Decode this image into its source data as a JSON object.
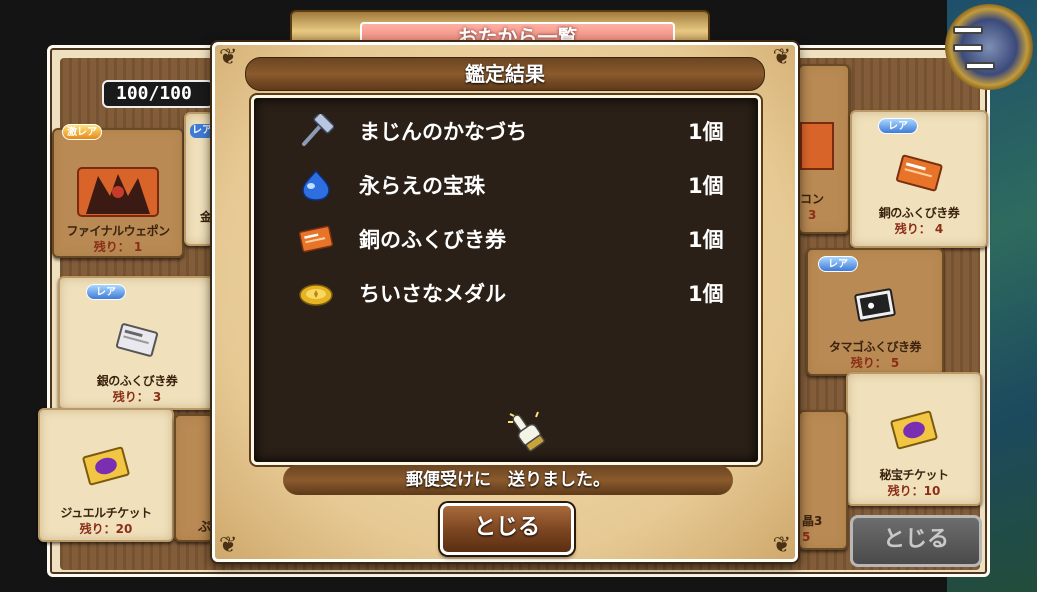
{
  "screen": {
    "title": "おたから一覧",
    "count": "100/100",
    "close_label": "とじる"
  },
  "background_cards": [
    {
      "badge": "激レア",
      "name": "ファイナルウェポン",
      "remain": "残り： 1",
      "icon": "monster-weapon-icon"
    },
    {
      "badge": "レア",
      "name": "銀のふくびき券",
      "remain": "残り： 3",
      "icon": "silver-ticket-icon"
    },
    {
      "badge": "",
      "name": "ジュエルチケット",
      "remain": "残り：20",
      "icon": "jewel-ticket-icon"
    },
    {
      "badge": "レア",
      "name": "銅のふくびき券",
      "remain": "残り： 4",
      "icon": "bronze-ticket-icon"
    },
    {
      "badge": "レア",
      "name": "タマゴふくびき券",
      "remain": "残り： 5",
      "icon": "egg-ticket-icon"
    },
    {
      "badge": "",
      "name": "秘宝チケット",
      "remain": "残り：10",
      "icon": "treasure-ticket-icon"
    }
  ],
  "background_partial": {
    "left_rare": "レア",
    "left_char": "金",
    "left_char2": "ぷ",
    "right_kon": "コン",
    "right_kon_num": "3",
    "right_crystal": "晶3",
    "right_crystal_num": "5"
  },
  "dialog": {
    "title": "鑑定結果",
    "items": [
      {
        "name": "まじんのかなづち",
        "qty": "1個",
        "icon": "hammer-icon"
      },
      {
        "name": "永らえの宝珠",
        "qty": "1個",
        "icon": "blue-orb-icon"
      },
      {
        "name": "銅のふくびき券",
        "qty": "1個",
        "icon": "bronze-ticket-icon"
      },
      {
        "name": "ちいさなメダル",
        "qty": "1個",
        "icon": "small-medal-icon"
      }
    ],
    "pointer_icon": "glove-pointer-icon",
    "notice": "郵便受けに　送りました。",
    "close_label": "とじる"
  },
  "colors": {
    "panel_bg": "#2a2017",
    "parchment": "#f0e1bc",
    "title_bar": "#8a5a2c",
    "rare_badge": "#3f7bd6",
    "super_rare_badge": "#e68a18"
  }
}
